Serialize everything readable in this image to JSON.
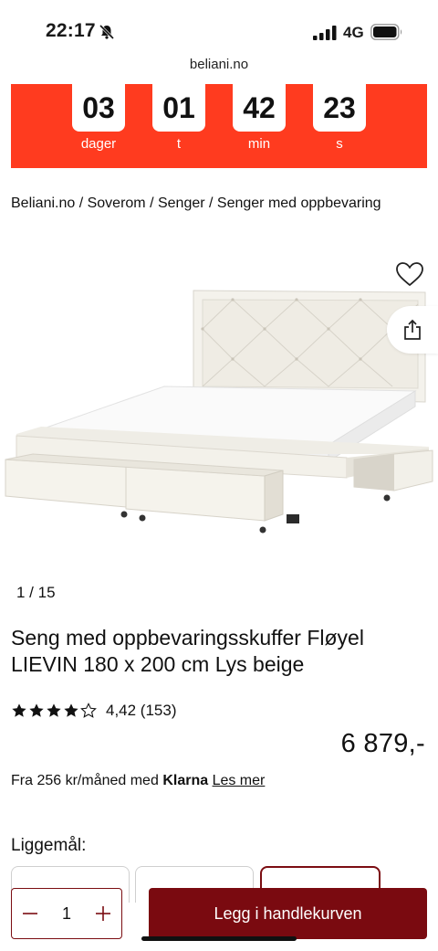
{
  "status": {
    "time": "22:17",
    "network": "4G"
  },
  "browser": {
    "url": "beliani.no"
  },
  "countdown": {
    "units": [
      {
        "value": "03",
        "label": "dager"
      },
      {
        "value": "01",
        "label": "t"
      },
      {
        "value": "42",
        "label": "min"
      },
      {
        "value": "23",
        "label": "s"
      }
    ]
  },
  "breadcrumb": "Beliani.no / Soverom / Senger / Senger med oppbevaring",
  "gallery": {
    "counter": "1 /  15"
  },
  "product": {
    "title": "Seng med oppbevaringsskuffer Fløyel LIEVIN 180 x 200 cm Lys beige",
    "rating_value": 4.42,
    "rating_text": "4,42 (153)",
    "price": "6 879,-"
  },
  "klarna": {
    "prefix": "Fra 256 kr/måned med",
    "brand": "Klarna",
    "link": "Les mer"
  },
  "size": {
    "label": "Liggemål:"
  },
  "cart": {
    "quantity": "1",
    "button": "Legg i handlekurven"
  },
  "colors": {
    "banner": "#ff3b1f",
    "cta": "#7a0a10"
  }
}
